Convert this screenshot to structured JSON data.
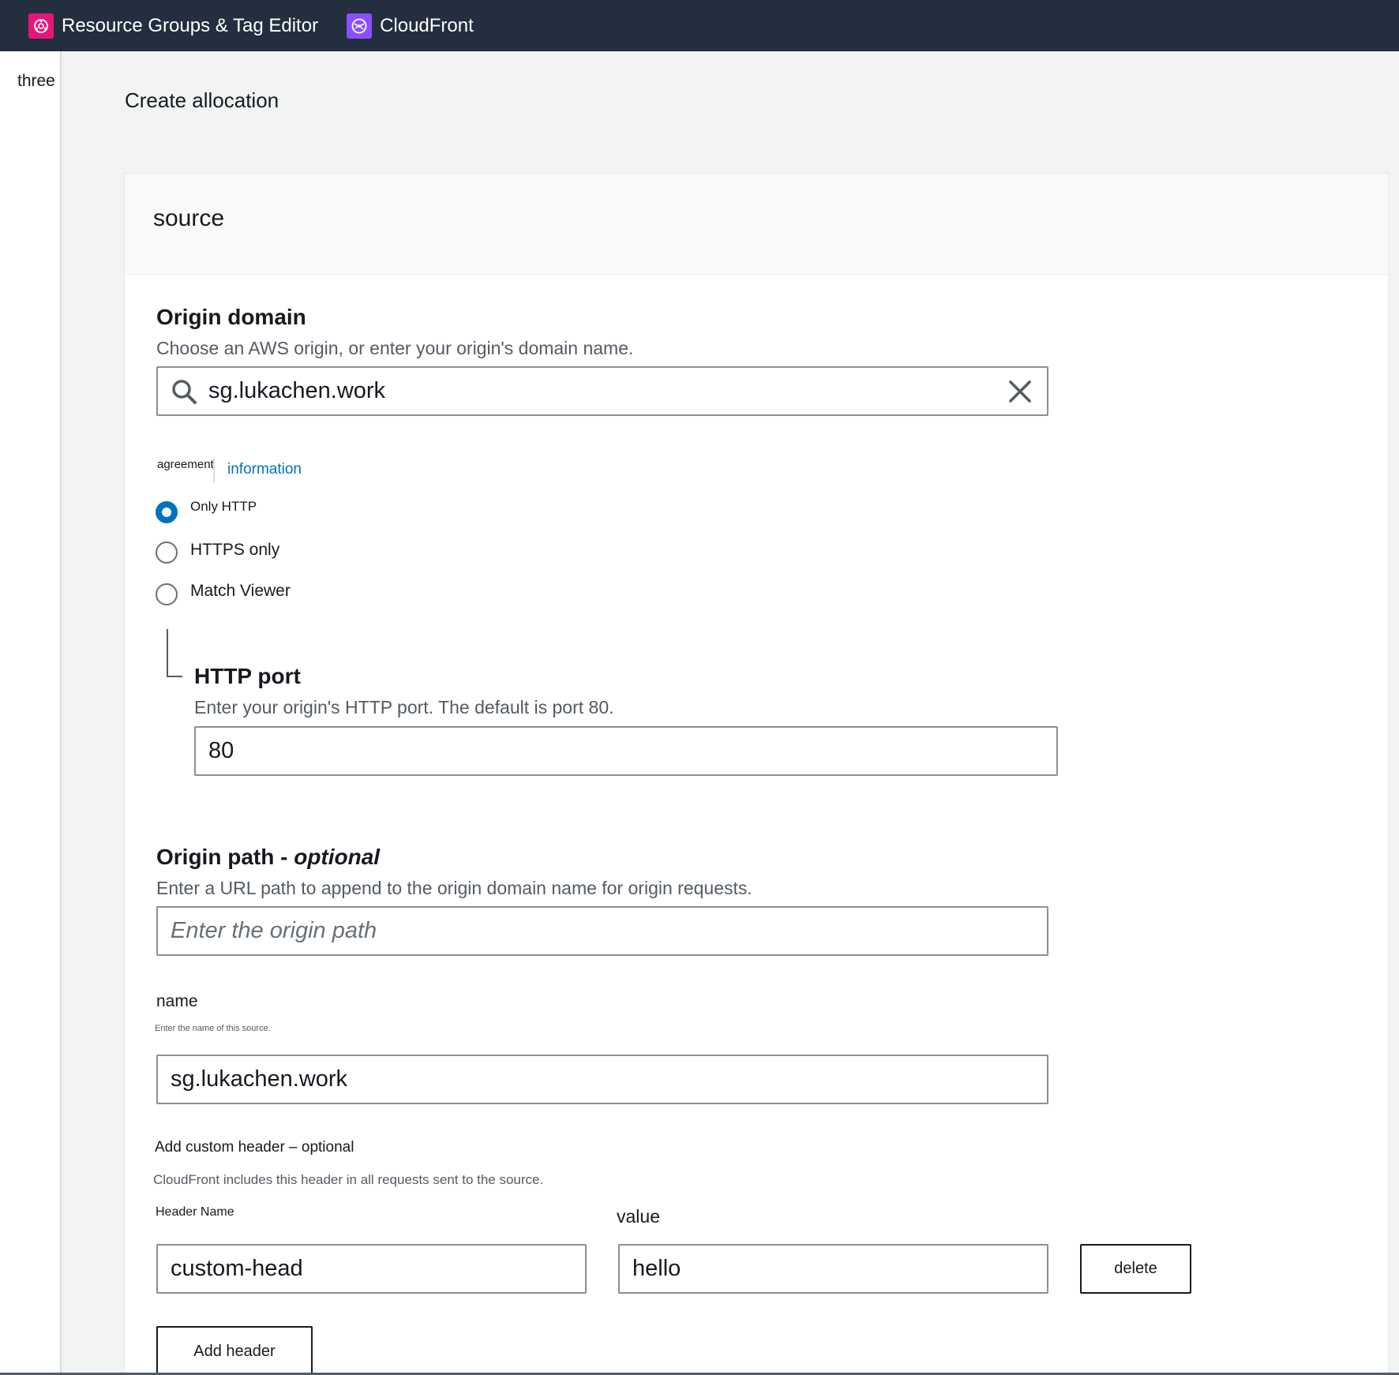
{
  "nav": {
    "favorites": [
      {
        "label": "Resource Groups & Tag Editor",
        "icon": "resource-groups-icon",
        "color": "#e7157b"
      },
      {
        "label": "CloudFront",
        "icon": "cloudfront-icon",
        "color": "#8c4fff"
      }
    ]
  },
  "sidebar": {
    "toggle_label": "three"
  },
  "page": {
    "title": "Create allocation"
  },
  "section": {
    "title": "source"
  },
  "origin_domain": {
    "label": "Origin domain",
    "description": "Choose an AWS origin, or enter your origin's domain name.",
    "value": "sg.lukachen.work"
  },
  "protocol": {
    "label": "agreement",
    "info_link": "information",
    "options": [
      {
        "label": "Only HTTP",
        "checked": true
      },
      {
        "label": "HTTPS only",
        "checked": false
      },
      {
        "label": "Match Viewer",
        "checked": false
      }
    ]
  },
  "http_port": {
    "label": "HTTP port",
    "description": "Enter your origin's HTTP port. The default is port 80.",
    "value": "80"
  },
  "origin_path": {
    "label": "Origin path - ",
    "label_optional": "optional",
    "description": "Enter a URL path to append to the origin domain name for origin requests.",
    "placeholder": "Enter the origin path"
  },
  "name_field": {
    "label": "name",
    "description": "Enter the name of this source.",
    "value": "sg.lukachen.work"
  },
  "custom_header": {
    "label": "Add custom header – optional",
    "description": "CloudFront includes this header in all requests sent to the source.",
    "header_name_label": "Header Name",
    "value_label": "value",
    "rows": [
      {
        "name": "custom-head",
        "value": "hello",
        "delete_label": "delete"
      }
    ],
    "add_button_label": "Add header"
  },
  "colors": {
    "nav_bg": "#232f3e",
    "accent": "#0073bb"
  }
}
